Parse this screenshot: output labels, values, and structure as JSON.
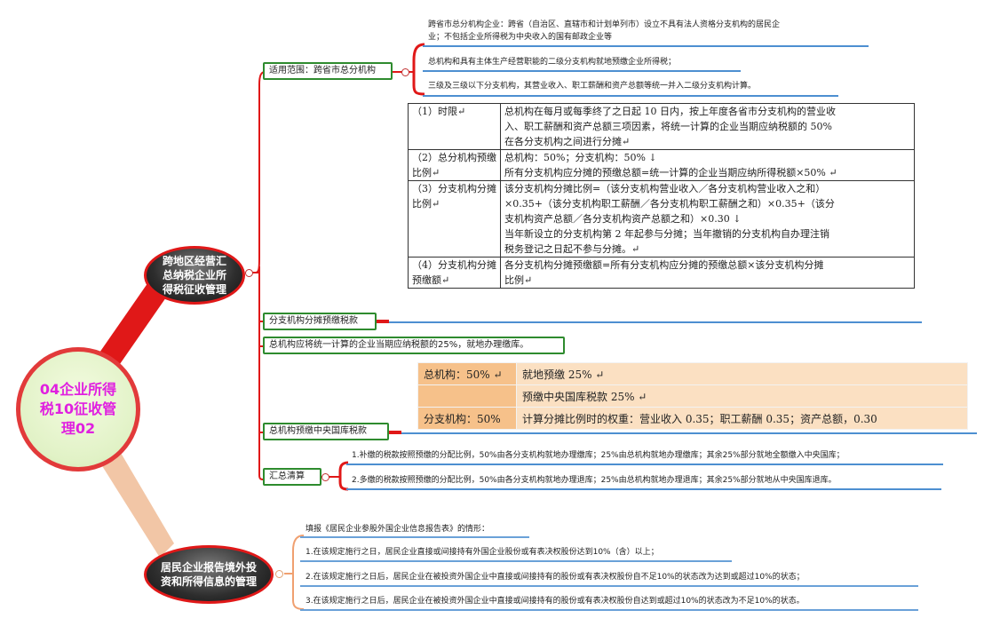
{
  "root": {
    "title": "04企业所得税10征收管理02"
  },
  "branches": {
    "b1": {
      "title": "跨地区经营汇总纳税企业所得税征收管理",
      "scope": {
        "label": "适用范围：跨省市总分机构",
        "notes": [
          "跨省市总分机构企业：跨省（自治区、直辖市和计划单列市）设立不具有法人资格分支机构的居民企",
          "业；不包括企业所得税为中央收入的国有邮政企业等",
          "总机构和具有主体生产经营职能的二级分支机构就地预缴企业所得税；",
          "三级及三级以下分支机构，其营业收入、职工薪酬和资产总额等统一并入二级分支机构计算。"
        ]
      },
      "prepay": {
        "label": "分支机构分摊预缴税款",
        "rows": [
          {
            "k": "（1）时限↵",
            "v": [
              "总机构在每月或每季终了之日起 10 日内，按上年度各省市分支机构的营业收",
              "入、职工薪酬和资产总额三项因素，将统一计算的企业当期应纳税额的 50%",
              "在各分支机构之间进行分摊↵"
            ]
          },
          {
            "k": "（2）总分机构预缴比例↵",
            "v": [
              "总机构：50%；分支机构：50% ↓",
              "所有分支机构应分摊的预缴总额=统一计算的企业当期应纳所得税额×50% ↵"
            ]
          },
          {
            "k": "（3）分支机构分摊比例↵",
            "v": [
              "该分支机构分摊比例=（该分支机构营业收入／各分支机构营业收入之和）",
              "×0.35+（该分支机构职工薪酬／各分支机构职工薪酬之和）×0.35+（该分",
              "支机构资产总额／各分支机构资产总额之和）×0.30 ↓",
              "当年新设立的分支机构第 2 年起参与分摊；当年撤销的分支机构自办理注销",
              "税务登记之日起不参与分摊。↵"
            ]
          },
          {
            "k": "（4）分支机构分摊预缴额↵",
            "v": [
              "各分支机构分摊预缴额=所有分支机构应分摊的预缴总额×该分支机构分摊",
              "比例↵"
            ]
          }
        ]
      },
      "central": {
        "text": "总机构应将统一计算的企业当期应纳税额的25%，就地办理缴库。",
        "label": "总机构预缴中央国库税款",
        "table": {
          "r1": [
            "总机构：50% ↵",
            "就地预缴 25% ↵"
          ],
          "r2": [
            "预缴中央国库税款 25% ↵"
          ],
          "r3": [
            "分支机构：50%",
            "计算分摊比例时的权重：营业收入 0.35；职工薪酬 0.35；资产总额，0.30"
          ]
        }
      },
      "settle": {
        "label": "汇总清算",
        "notes": [
          "1.补缴的税款按照预缴的分配比例，50%由各分支机构就地办理缴库；25%由总机构就地办理缴库；其余25%部分就地全额缴入中央国库；",
          "2.多缴的税款按照预缴的分配比例，50%由各分支机构就地办理退库；25%由总机构就地办理退库；其余25%部分就地从中央国库退库。"
        ]
      }
    },
    "b2": {
      "title": "居民企业报告境外投资和所得信息的管理",
      "notes": [
        "填报《居民企业参股外国企业信息报告表》的情形：",
        "1.在该规定施行之日，居民企业直接或间接持有外国企业股份或有表决权股份达到10%（含）以上；",
        "2.在该规定施行之日后，居民企业在被投资外国企业中直接或间接持有的股份或有表决权股份自不足10%的状态改为达到或超过10%的状态；",
        "3.在该规定施行之日后，居民企业在被投资外国企业中直接或间接持有的股份或有表决权股份自达到或超过10%的状态改为不足10%的状态。"
      ]
    }
  },
  "colors": {
    "root_border": "#e23a3a",
    "accent_text": "#e020e0",
    "box_border": "#2e8b2e",
    "underline": "#4d8fd1",
    "link": "#e01818"
  }
}
